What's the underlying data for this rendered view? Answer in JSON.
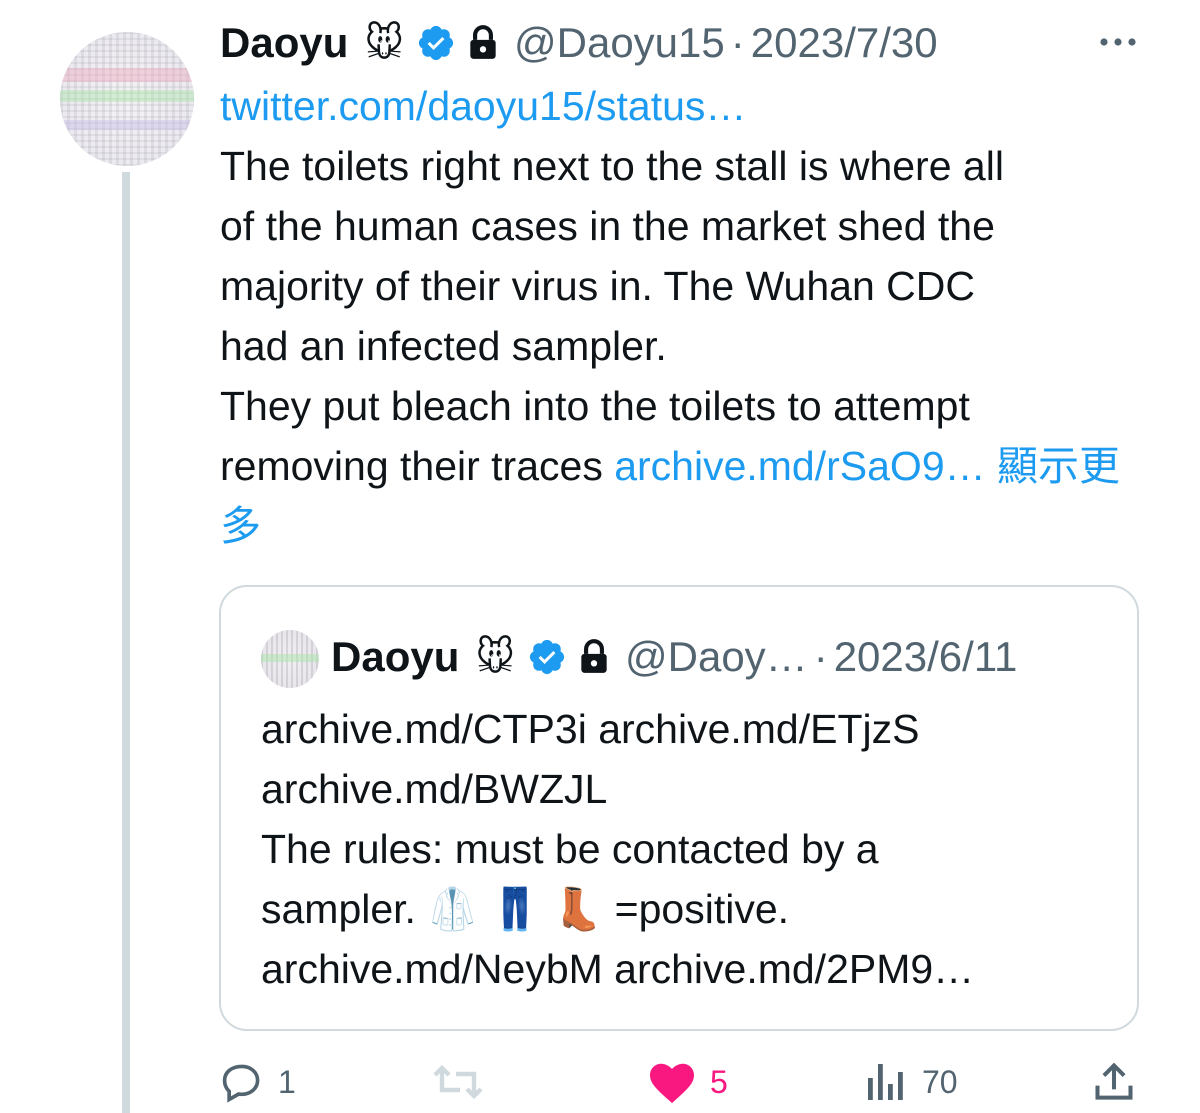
{
  "tweet": {
    "author_name": "Daoyu",
    "author_emoji": "🐭",
    "handle": "@Daoyu15",
    "separator": "·",
    "date": "2023/7/30",
    "link_top": "twitter.com/daoyu15/status…",
    "body_lines": [
      "The toilets right next to the stall is where all",
      "of the human cases in the market shed the",
      "majority of their virus in. The Wuhan CDC",
      "had an infected sampler.",
      "They put bleach into the toilets to attempt"
    ],
    "body_last_prefix": "removing their traces ",
    "body_last_link": "archive.md/rSaO9…",
    "show_more": " 顯示更多"
  },
  "quote": {
    "author_name": "Daoyu",
    "author_emoji": "🐭",
    "handle": "@Daoy…",
    "separator": "·",
    "date": "2023/6/11",
    "lines": [
      "archive.md/CTP3i archive.md/ETjzS",
      "archive.md/BWZJL",
      "The rules: must be contacted by a",
      "sampler. 🥼 👖 👢 =positive.",
      "archive.md/NeybM archive.md/2PM9…"
    ]
  },
  "actions": {
    "reply_count": "1",
    "retweet_count": "",
    "like_count": "5",
    "views_count": "70"
  },
  "colors": {
    "link": "#1d9bf0",
    "verified": "#1d9bf0",
    "secondary_text": "#536471",
    "like": "#f91880",
    "border": "#cfd9de"
  },
  "icons": {
    "verified": "verified-badge-icon",
    "lock": "lock-icon",
    "more": "more-options-icon",
    "reply": "reply-icon",
    "retweet": "retweet-icon",
    "like": "heart-filled-icon",
    "views": "views-chart-icon",
    "share": "share-icon"
  }
}
